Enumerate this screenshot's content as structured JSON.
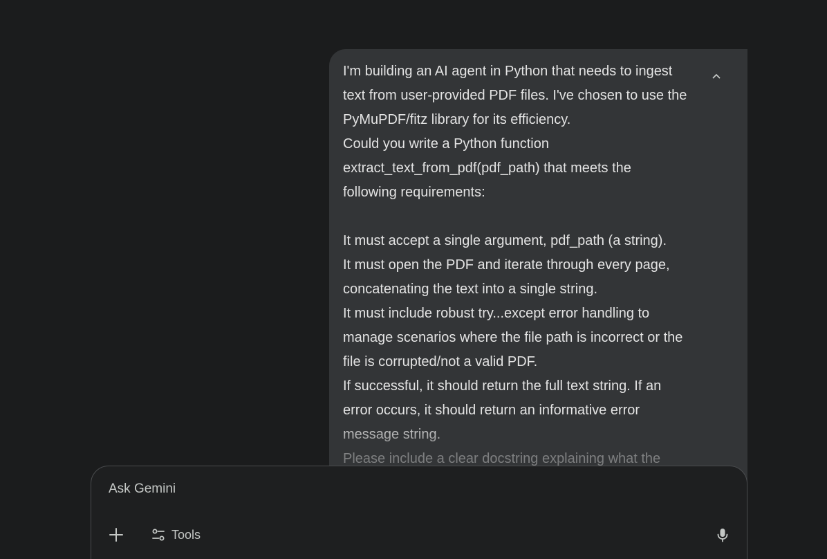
{
  "user_message": {
    "lines": [
      "I'm building an AI agent in Python that needs to ingest",
      "text from user-provided PDF files. I've chosen to use the",
      "PyMuPDF/fitz library for its efficiency.",
      "Could you write a Python function",
      "extract_text_from_pdf(pdf_path) that meets the",
      "following requirements:",
      "",
      "It must accept a single argument, pdf_path (a string).",
      "It must open the PDF and iterate through every page,",
      "concatenating the text into a single string.",
      "It must include robust try...except error handling to",
      "manage scenarios where the file path is incorrect or the",
      "file is corrupted/not a valid PDF.",
      "If successful, it should return the full text string. If an",
      "error occurs, it should return an informative error",
      "message string.",
      "Please include a clear docstring explaining what the"
    ],
    "collapse_icon": "chevron-up-icon"
  },
  "input": {
    "placeholder": "Ask Gemini",
    "add_icon": "plus-icon",
    "tools_label": "Tools",
    "tools_icon": "sliders-icon",
    "mic_icon": "microphone-icon"
  },
  "colors": {
    "background": "#1b1c1d",
    "bubble": "#333537",
    "text": "#e3e3e3",
    "muted_text": "#c4c7c5",
    "input_border": "#4a4c4e"
  }
}
